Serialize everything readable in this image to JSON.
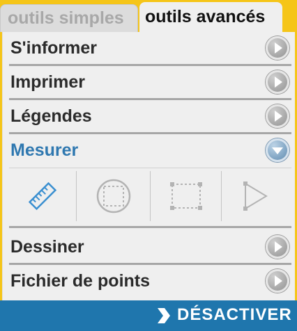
{
  "tabs": {
    "simple_label": "outils simples",
    "advanced_label": "outils avancés"
  },
  "menu": {
    "items": [
      {
        "label": "S'informer",
        "icon": "play-arrow-icon"
      },
      {
        "label": "Imprimer",
        "icon": "play-arrow-icon"
      },
      {
        "label": "Légendes",
        "icon": "play-arrow-icon"
      },
      {
        "label": "Mesurer",
        "icon": "chevron-down-icon",
        "expanded": true
      },
      {
        "label": "Dessiner",
        "icon": "play-arrow-icon"
      },
      {
        "label": "Fichier de points",
        "icon": "play-arrow-icon"
      }
    ]
  },
  "measure_tools": [
    {
      "icon": "ruler-icon",
      "active": true
    },
    {
      "icon": "circle-measure-icon",
      "active": false
    },
    {
      "icon": "rectangle-measure-icon",
      "active": false
    },
    {
      "icon": "polygon-measure-icon",
      "active": false
    }
  ],
  "footer": {
    "deactivate_label": "DÉSACTIVER"
  },
  "colors": {
    "frame": "#f5c518",
    "panel": "#efefef",
    "active_text": "#2f78b0",
    "footer": "#1f76ad"
  }
}
